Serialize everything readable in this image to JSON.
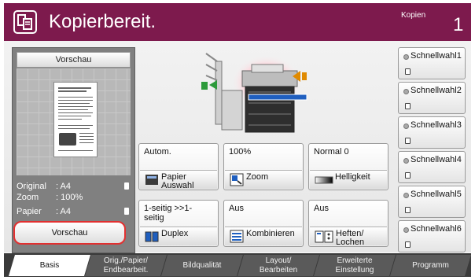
{
  "header": {
    "title": "Kopierbereit.",
    "copies_label": "Kopien",
    "copies_value": "1",
    "icon": "copy-app-icon"
  },
  "preview": {
    "title": "Vorschau",
    "info": [
      {
        "key": "Original",
        "value": ": A4"
      },
      {
        "key": "Zoom",
        "value": ": 100%"
      },
      {
        "key": "Papier",
        "value": ": A4"
      }
    ],
    "button_label": "Vorschau"
  },
  "functions": {
    "papier": {
      "value": "Autom.",
      "label": "Papier Auswahl",
      "icon": "paper-tray-icon"
    },
    "zoom": {
      "value": "100%",
      "label": "Zoom",
      "icon": "zoom-icon"
    },
    "helligkeit": {
      "value": "Normal 0",
      "label": "Helligkeit",
      "icon": "density-icon"
    },
    "duplex": {
      "value": "1-seitig >>1-seitig",
      "label": "Duplex",
      "icon": "duplex-icon"
    },
    "kombinieren": {
      "value": "Aus",
      "label": "Kombinieren",
      "icon": "combine-icon"
    },
    "heften": {
      "value": "Aus",
      "label": "Heften/ Lochen",
      "icon": "staple-punch-icon"
    }
  },
  "quick_buttons": [
    "Schnellwahl1",
    "Schnellwahl2",
    "Schnellwahl3",
    "Schnellwahl4",
    "Schnellwahl5",
    "Schnellwahl6"
  ],
  "tabs": [
    {
      "label": "Basis",
      "active": true
    },
    {
      "label": "Orig./Papier/ Endbearbeit.",
      "active": false
    },
    {
      "label": "Bildqualität",
      "active": false
    },
    {
      "label": "Layout/ Bearbeiten",
      "active": false
    },
    {
      "label": "Erweiterte Einstellung",
      "active": false
    },
    {
      "label": "Programm",
      "active": false
    }
  ],
  "colors": {
    "header_bg": "#7d1a4d",
    "preview_highlight": "#e23030",
    "tab_bar": "#3a3a3a"
  }
}
